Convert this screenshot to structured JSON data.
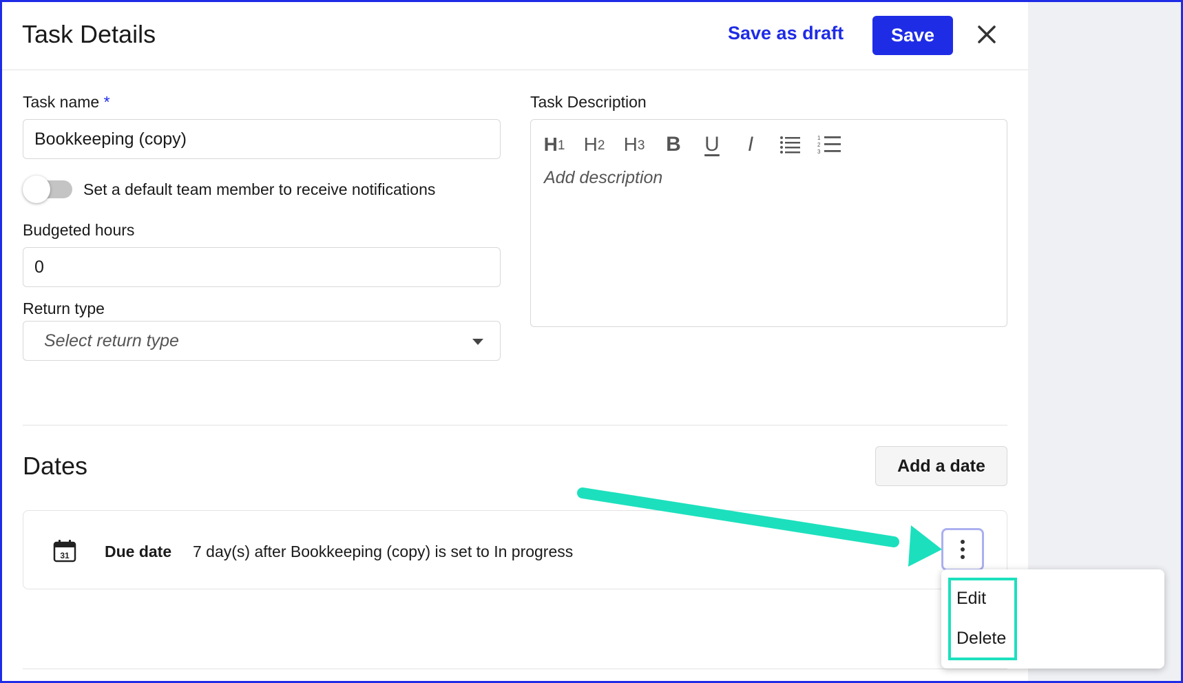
{
  "header": {
    "title": "Task Details",
    "save_draft_label": "Save as draft",
    "save_label": "Save",
    "close_icon": "close-icon"
  },
  "form": {
    "task_name": {
      "label": "Task name",
      "required_mark": "*",
      "value": "Bookkeeping (copy)"
    },
    "notifications_toggle": {
      "label": "Set a default team member to receive notifications",
      "on": false
    },
    "budgeted_hours": {
      "label": "Budgeted hours",
      "value": "0"
    },
    "return_type": {
      "label": "Return type",
      "placeholder": "Select return type"
    },
    "description": {
      "label": "Task Description",
      "placeholder": "Add description",
      "toolbar": [
        {
          "name": "heading-1",
          "text": "H",
          "sub": "1"
        },
        {
          "name": "heading-2",
          "text": "H",
          "sub": "2"
        },
        {
          "name": "heading-3",
          "text": "H",
          "sub": "3"
        },
        {
          "name": "bold",
          "text": "B"
        },
        {
          "name": "underline",
          "text": "U"
        },
        {
          "name": "italic",
          "text": "I"
        },
        {
          "name": "bulleted-list-icon"
        },
        {
          "name": "numbered-list-icon",
          "numbers": "123"
        }
      ]
    }
  },
  "dates": {
    "title": "Dates",
    "add_label": "Add a date",
    "items": [
      {
        "icon": "calendar-icon",
        "icon_day": "31",
        "label": "Due date",
        "text": "7 day(s) after Bookkeeping (copy) is set to In progress"
      }
    ]
  },
  "menu": {
    "items": [
      "Edit",
      "Delete"
    ]
  },
  "colors": {
    "accent": "#1f2ce6",
    "annotation": "#1ce0bd"
  }
}
